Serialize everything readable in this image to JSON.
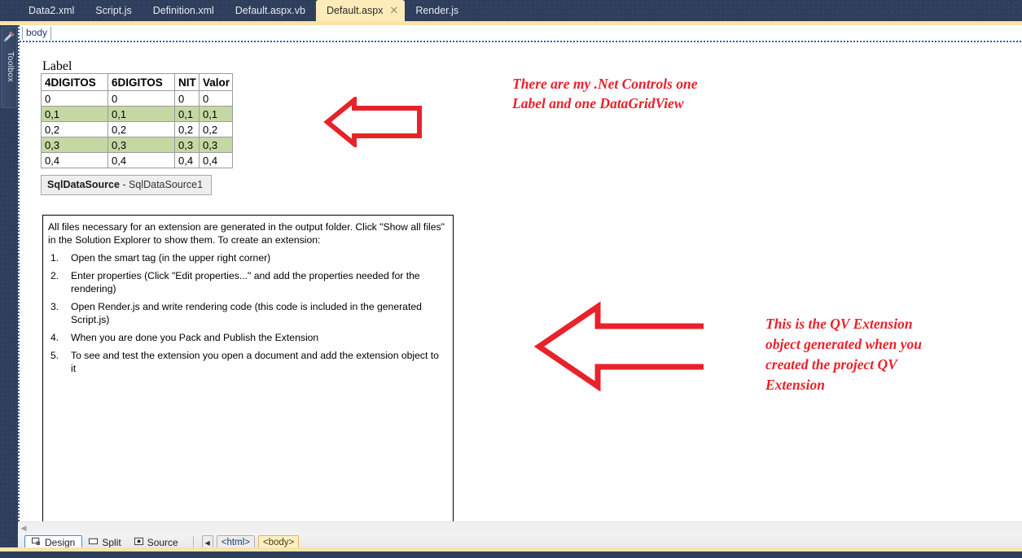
{
  "window": {
    "tabs": [
      {
        "label": "Data2.xml",
        "active": false,
        "closable": false
      },
      {
        "label": "Script.js",
        "active": false,
        "closable": false
      },
      {
        "label": "Definition.xml",
        "active": false,
        "closable": false
      },
      {
        "label": "Default.aspx.vb",
        "active": false,
        "closable": false
      },
      {
        "label": "Default.aspx",
        "active": true,
        "closable": true,
        "close_glyph": "✕"
      },
      {
        "label": "Render.js",
        "active": false,
        "closable": false
      }
    ]
  },
  "toolbox": {
    "label": "Toolbox",
    "icon": "tools-icon"
  },
  "designer": {
    "body_tag": "body",
    "label_control_text": "Label",
    "grid": {
      "headers": [
        "4DIGITOS",
        "6DIGITOS",
        "NIT",
        "Valor"
      ],
      "rows": [
        [
          "0",
          "0",
          "0",
          "0"
        ],
        [
          "0,1",
          "0,1",
          "0,1",
          "0,1"
        ],
        [
          "0,2",
          "0,2",
          "0,2",
          "0,2"
        ],
        [
          "0,3",
          "0,3",
          "0,3",
          "0,3"
        ],
        [
          "0,4",
          "0,4",
          "0,4",
          "0,4"
        ]
      ],
      "alt_row_color": "#c5d8a4"
    },
    "sqldatasource": {
      "type": "SqlDataSource",
      "separator": " - ",
      "id": "SqlDataSource1"
    },
    "extension_panel": {
      "intro": "All files necessary for an extension are generated in the output folder. Click \"Show all files\" in the Solution Explorer to show them. To create an extension:",
      "steps": [
        "Open the smart tag (in the upper right corner)",
        "Enter properties (Click \"Edit properties...\" and add the properties needed for the rendering)",
        "Open Render.js and write rendering code (this code is included in the generated Script.js)",
        "When you are done you Pack and Publish the Extension",
        "To see and test the extension you open a document and add the extension object to it"
      ]
    }
  },
  "annotations": {
    "color": "#e8222a",
    "items": [
      {
        "name": "net-controls-note",
        "text": "There are my .Net Controls one\nLabel and one DataGridView"
      },
      {
        "name": "qv-extension-note",
        "text": "This is the QV Extension\nobject generated when you\ncreated the project QV\nExtension"
      }
    ],
    "arrows": [
      {
        "name": "arrow-to-datagrid",
        "direction": "left"
      },
      {
        "name": "arrow-to-extension-object",
        "direction": "left"
      }
    ]
  },
  "bottom_bar": {
    "view_buttons": [
      {
        "label": "Design",
        "icon": "design-view-icon",
        "selected": true
      },
      {
        "label": "Split",
        "icon": "split-view-icon",
        "selected": false
      },
      {
        "label": "Source",
        "icon": "source-view-icon",
        "selected": false
      }
    ],
    "nav_glyph": "◀",
    "breadcrumbs": [
      {
        "label": "<html>",
        "active": false
      },
      {
        "label": "<body>",
        "active": true
      }
    ]
  },
  "scrollbar": {
    "left_arrow_glyph": "◀"
  }
}
